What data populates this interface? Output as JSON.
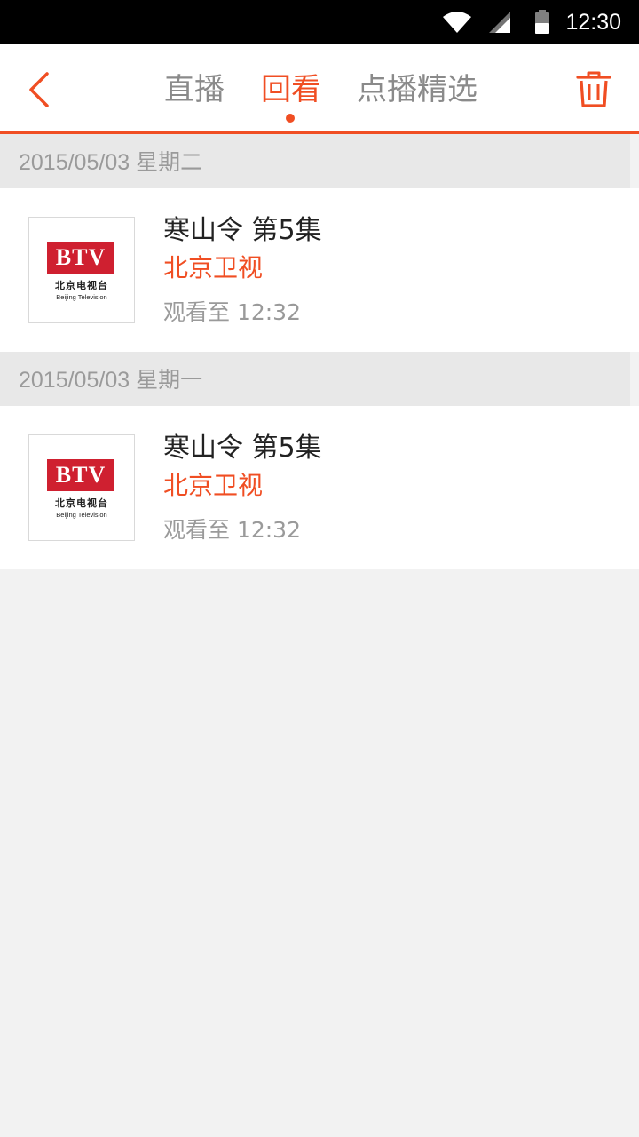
{
  "status_bar": {
    "time": "12:30",
    "icons": [
      "wifi-icon",
      "cell-signal-icon",
      "battery-icon"
    ]
  },
  "header": {
    "tabs": [
      {
        "label": "直播",
        "active": false
      },
      {
        "label": "回看",
        "active": true
      },
      {
        "label": "点播精选",
        "active": false
      }
    ],
    "back_icon": "chevron-left-icon",
    "delete_icon": "trash-icon"
  },
  "colors": {
    "accent": "#f04e23",
    "logo_red": "#cf2030",
    "section_bg": "#e8e8e8",
    "page_bg": "#f2f2f2",
    "muted_text": "#9a9a9a"
  },
  "groups": [
    {
      "date": "2015/05/03",
      "weekday": "星期二",
      "items": [
        {
          "title": "寒山令 第5集",
          "channel": "北京卫视",
          "progress": "观看至 12:32",
          "logo": {
            "mark": "BTV",
            "name_cn": "北京电视台",
            "name_en": "Beijing Television"
          }
        }
      ]
    },
    {
      "date": "2015/05/03",
      "weekday": "星期一",
      "items": [
        {
          "title": "寒山令 第5集",
          "channel": "北京卫视",
          "progress": "观看至 12:32",
          "logo": {
            "mark": "BTV",
            "name_cn": "北京电视台",
            "name_en": "Beijing Television"
          }
        }
      ]
    }
  ]
}
